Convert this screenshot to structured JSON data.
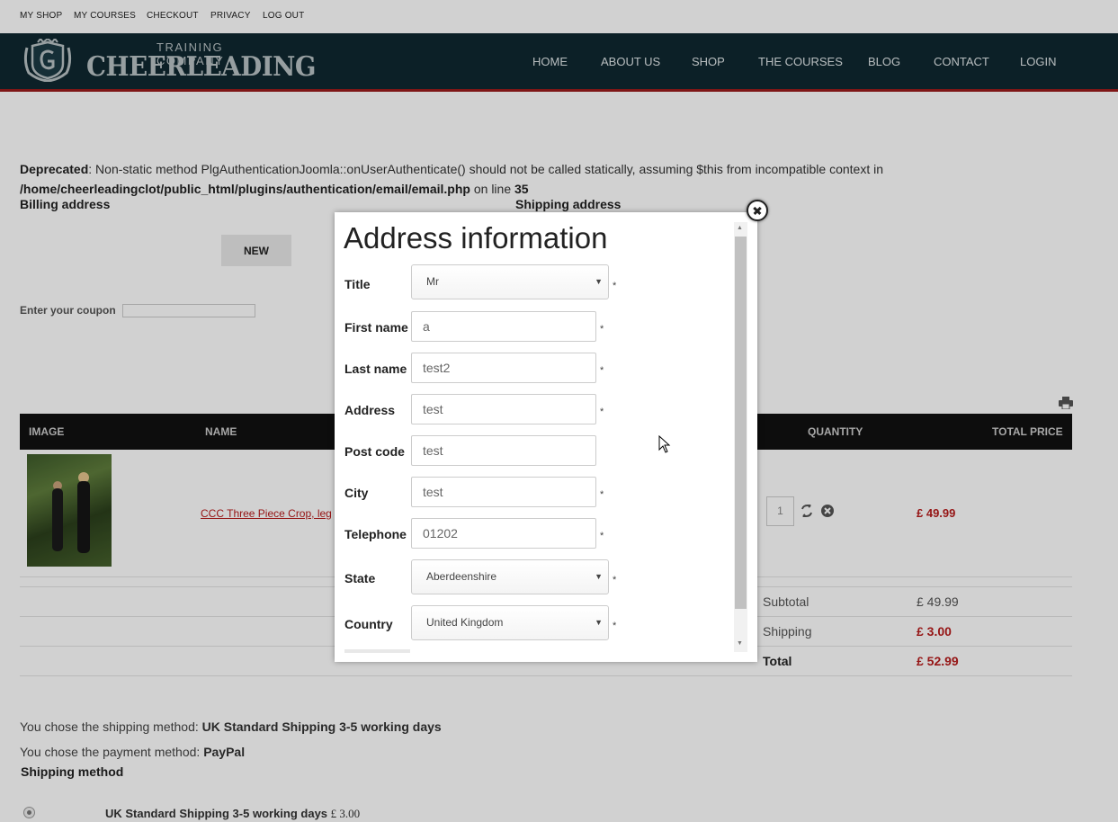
{
  "topbar": {
    "links": [
      "MY SHOP",
      "MY COURSES",
      "CHECKOUT",
      "PRIVACY",
      "LOG OUT"
    ]
  },
  "header": {
    "logo_sub": "TRAINING COMPANY",
    "logo_main": "CHEERLEADING",
    "nav": [
      "HOME",
      "ABOUT US",
      "SHOP",
      "THE COURSES",
      "BLOG",
      "CONTACT",
      "LOGIN"
    ]
  },
  "deprecated": {
    "label": "Deprecated",
    "message": ": Non-static method PlgAuthenticationJoomla::onUserAuthenticate() should not be called statically, assuming $this from incompatible context in",
    "path": "/home/cheerleadingclot/public_html/plugins/authentication/email/email.php",
    "line_text": " on line ",
    "line_no": "35"
  },
  "billing_heading": "Billing address",
  "shipping_heading": "Shipping address",
  "new_button": "NEW",
  "coupon_label": "Enter your coupon",
  "table": {
    "headers": {
      "image": "IMAGE",
      "name": "NAME",
      "quantity": "QUANTITY",
      "total_price": "TOTAL PRICE"
    },
    "row": {
      "name": "CCC Three Piece Crop, leg",
      "quantity": "1",
      "price": "£ 49.99"
    }
  },
  "totals": {
    "subtotal_label": "Subtotal",
    "subtotal": "£ 49.99",
    "shipping_label": "Shipping",
    "shipping": "£ 3.00",
    "total_label": "Total",
    "total": "£ 52.99"
  },
  "chosen": {
    "shipping_prefix": "You chose the shipping method: ",
    "shipping_value": "UK Standard Shipping 3-5 working days",
    "payment_prefix": "You chose the payment method: ",
    "payment_value": "PayPal"
  },
  "shipping_method_heading": "Shipping method",
  "shipping_option": {
    "label": "UK Standard Shipping 3-5 working days",
    "price": "£ 3.00"
  },
  "modal": {
    "title": "Address information",
    "required_mark": "*",
    "fields": {
      "title": {
        "label": "Title",
        "value": "Mr"
      },
      "first_name": {
        "label": "First name",
        "value": "a"
      },
      "last_name": {
        "label": "Last name",
        "value": "test2"
      },
      "address": {
        "label": "Address",
        "value": "test"
      },
      "post_code": {
        "label": "Post code",
        "value": "test"
      },
      "city": {
        "label": "City",
        "value": "test"
      },
      "telephone": {
        "label": "Telephone",
        "value": "01202"
      },
      "state": {
        "label": "State",
        "value": "Aberdeenshire"
      },
      "country": {
        "label": "Country",
        "value": "United Kingdom"
      }
    }
  },
  "colors": {
    "header_bg": "#0f2830",
    "accent_red": "#b81c1c",
    "header_border": "#9a1b1b"
  }
}
